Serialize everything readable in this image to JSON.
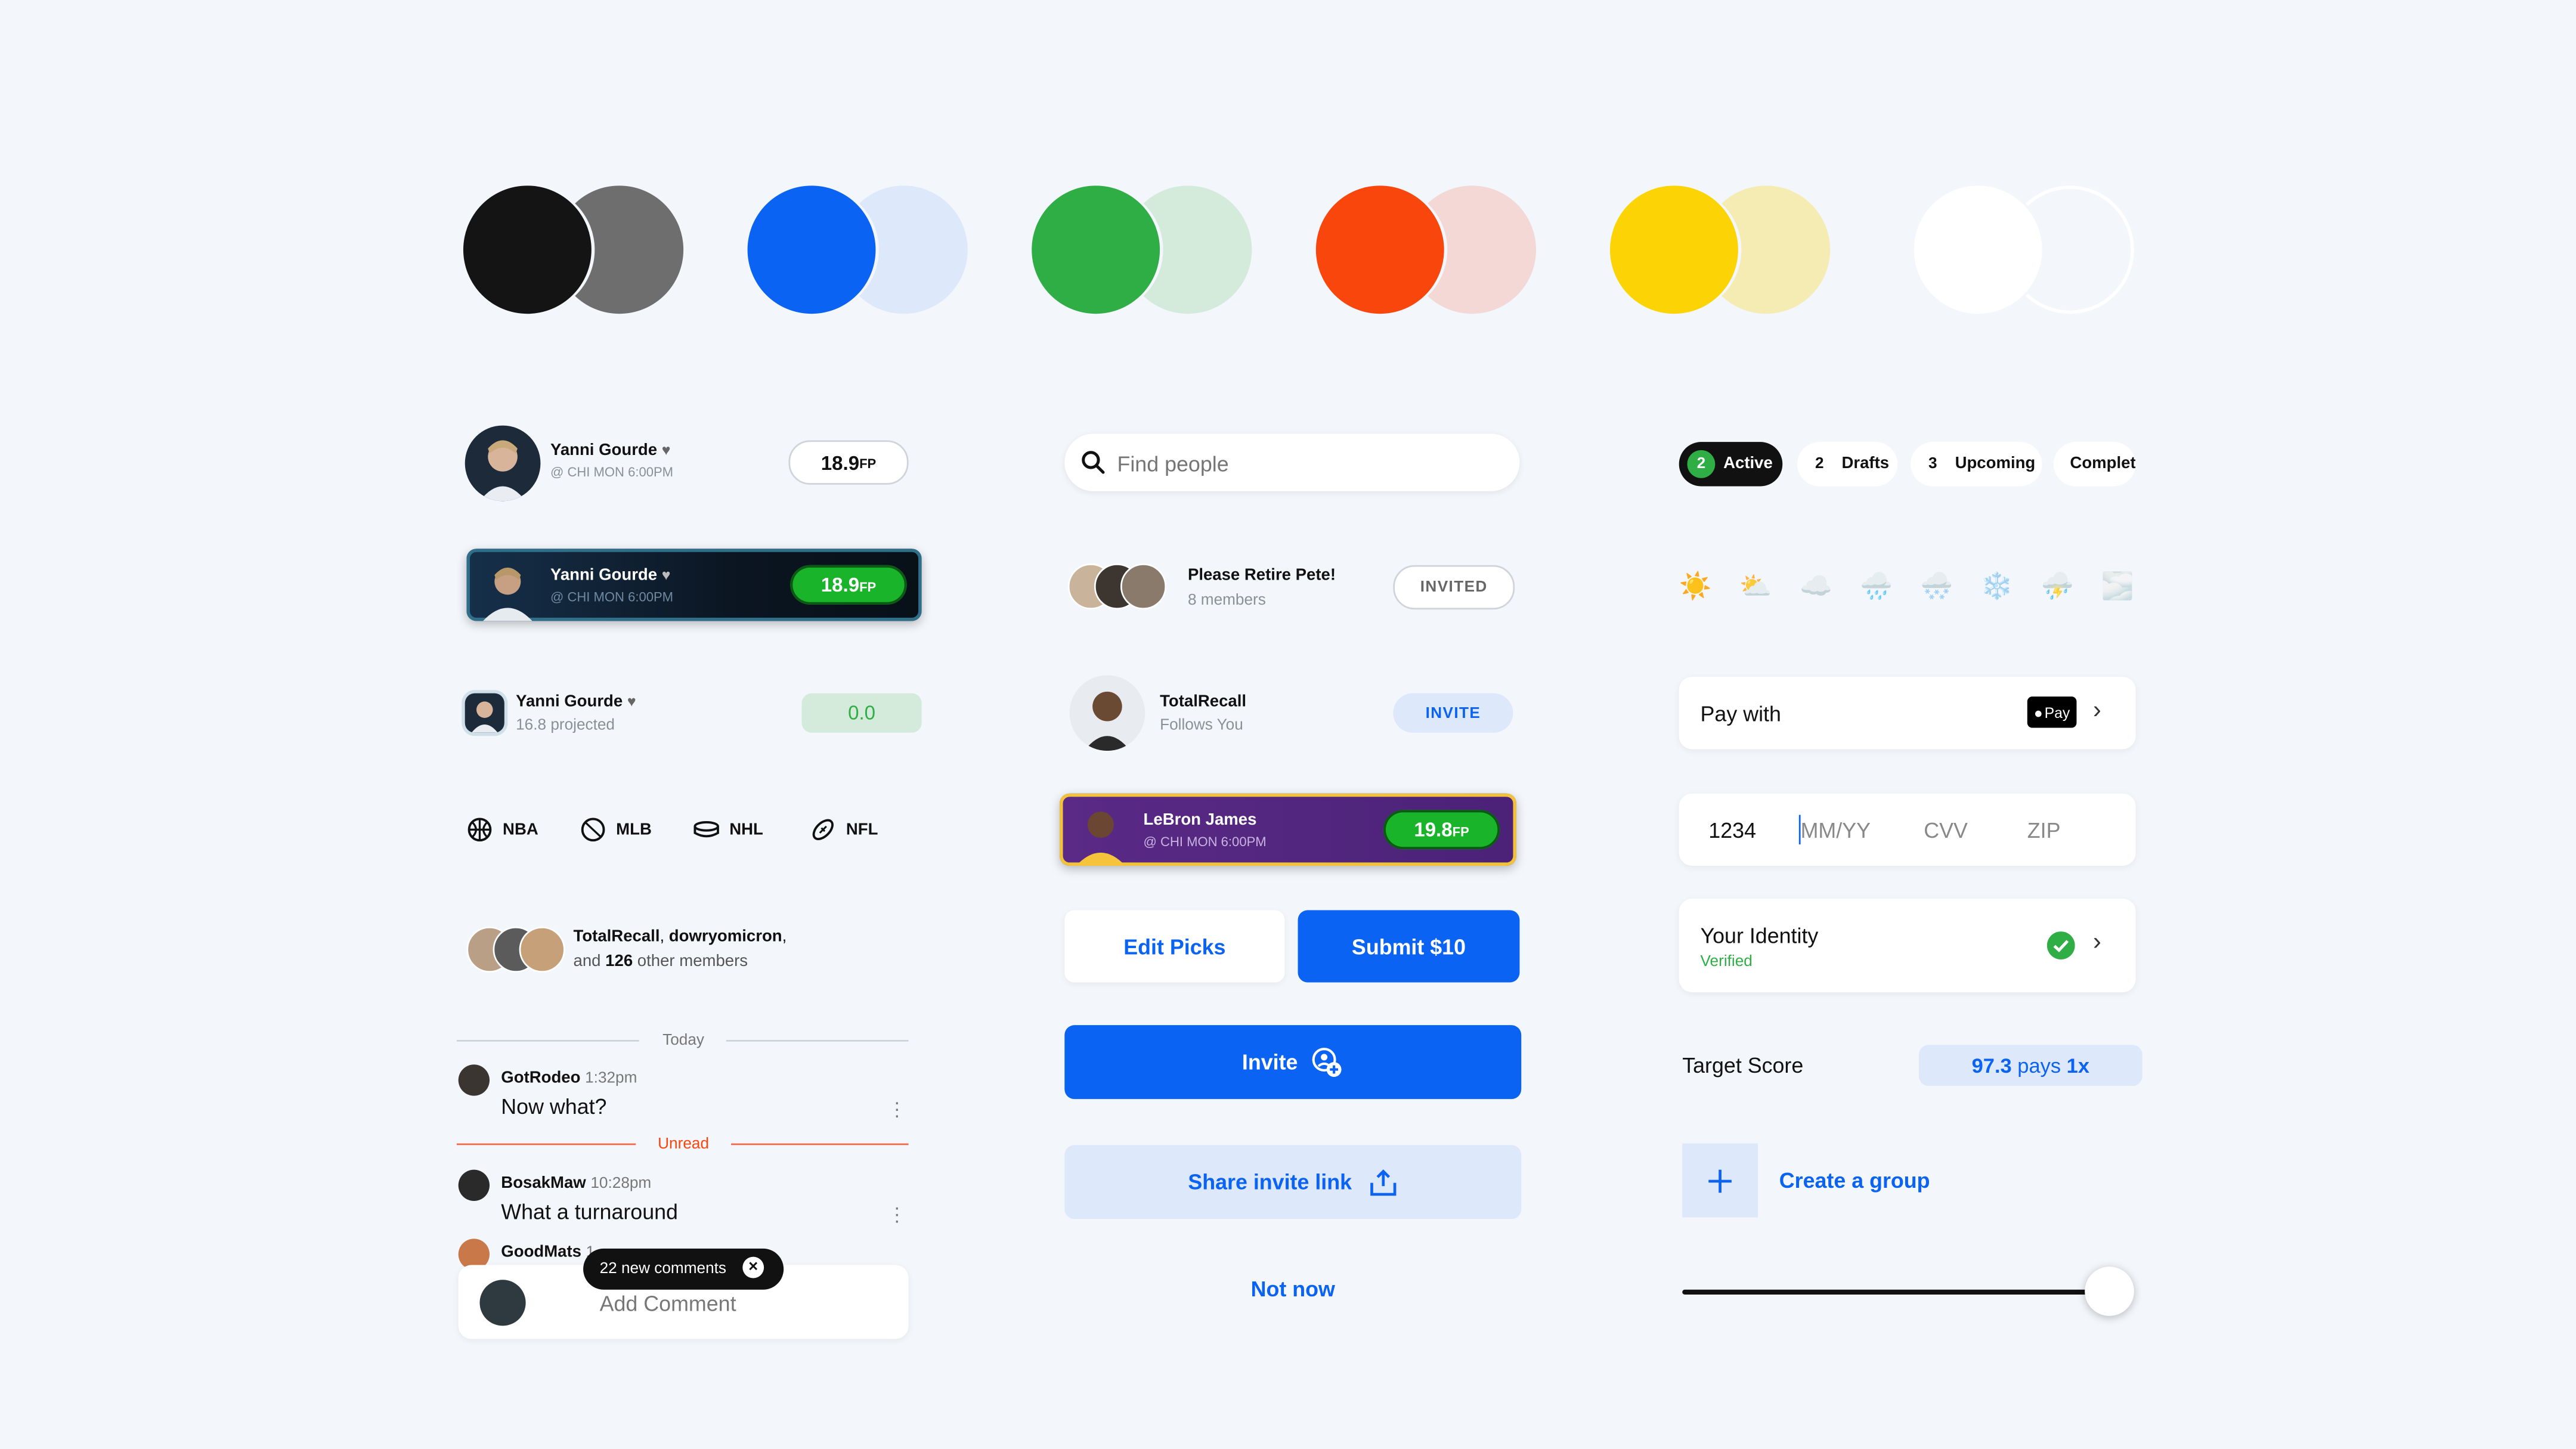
{
  "palette": {
    "pairs": [
      {
        "strong": "#141414",
        "light": "#6e6e6e"
      },
      {
        "strong": "#0a63f3",
        "light": "#dde8fb"
      },
      {
        "strong": "#2fae45",
        "light": "#d4ebdc"
      },
      {
        "strong": "#f8460c",
        "light": "#f3d8d6"
      },
      {
        "strong": "#fcd405",
        "light": "#f5ecb3"
      },
      {
        "strong": "#ffffff",
        "light": "#f3f6fb"
      }
    ]
  },
  "colors": {
    "accent": "#0a63f3",
    "success": "#2fae45",
    "danger": "#f8460c",
    "background": "#f3f6fb"
  },
  "player_card_1": {
    "name": "Yanni Gourde",
    "subtitle": "@ CHI MON 6:00PM",
    "score": "18.9",
    "unit": "FP"
  },
  "player_card_2": {
    "name": "Yanni Gourde",
    "subtitle": "@ CHI MON 6:00PM",
    "score": "18.9",
    "unit": "FP"
  },
  "player_card_3": {
    "name": "Yanni Gourde",
    "subtitle": "16.8 projected",
    "score": "0.0"
  },
  "sports": [
    {
      "label": "NBA",
      "icon": "basketball-icon"
    },
    {
      "label": "MLB",
      "icon": "baseball-icon"
    },
    {
      "label": "NHL",
      "icon": "hockey-puck-icon"
    },
    {
      "label": "NFL",
      "icon": "football-icon"
    }
  ],
  "members": {
    "names_bold": "TotalRecall",
    "sep": ", ",
    "name2": "dowryomicron",
    "comma": ",",
    "and": "and",
    "count": "126",
    "rest": "other members"
  },
  "chat": {
    "divider_today": "Today",
    "divider_unread": "Unread",
    "messages": [
      {
        "user": "GotRodeo",
        "time": "1:32pm",
        "text": "Now what?"
      },
      {
        "user": "BosakMaw",
        "time": "10:28pm",
        "text": "What a turnaround"
      },
      {
        "user": "GoodMats",
        "time": "1"
      }
    ],
    "new_comments": "22 new comments",
    "add_comment_placeholder": "Add Comment"
  },
  "search": {
    "placeholder": "Find people"
  },
  "group_row": {
    "title": "Please Retire Pete!",
    "subtitle": "8 members",
    "button": "INVITED"
  },
  "user_row": {
    "name": "TotalRecall",
    "subtitle": "Follows You",
    "button": "INVITE"
  },
  "lebron_card": {
    "name": "LeBron James",
    "subtitle": "@ CHI MON 6:00PM",
    "score": "19.8",
    "unit": "FP"
  },
  "buttons": {
    "edit_picks": "Edit Picks",
    "submit": "Submit $10",
    "invite": "Invite",
    "share": "Share invite link",
    "not_now": "Not now"
  },
  "tabs": [
    {
      "count": "2",
      "label": "Active",
      "active": true
    },
    {
      "count": "2",
      "label": "Drafts",
      "active": false
    },
    {
      "count": "3",
      "label": "Upcoming",
      "active": false
    },
    {
      "count": "",
      "label": "Complet",
      "active": false
    }
  ],
  "weather": [
    "☀️",
    "⛅",
    "☁️",
    "🌧️",
    "🌨️",
    "❄️",
    "⛈️",
    "🌫️"
  ],
  "pay": {
    "label": "Pay with",
    "badge": "Pay"
  },
  "card_input": {
    "number": "1234",
    "expiry": "MM/YY",
    "cvv": "CVV",
    "zip": "ZIP"
  },
  "identity": {
    "title": "Your Identity",
    "status": "Verified"
  },
  "target": {
    "label": "Target Score",
    "value": "97.3",
    "pays": "pays",
    "multiplier": "1x"
  },
  "create_group": {
    "label": "Create a group"
  },
  "slider": {
    "value": 1.0
  }
}
